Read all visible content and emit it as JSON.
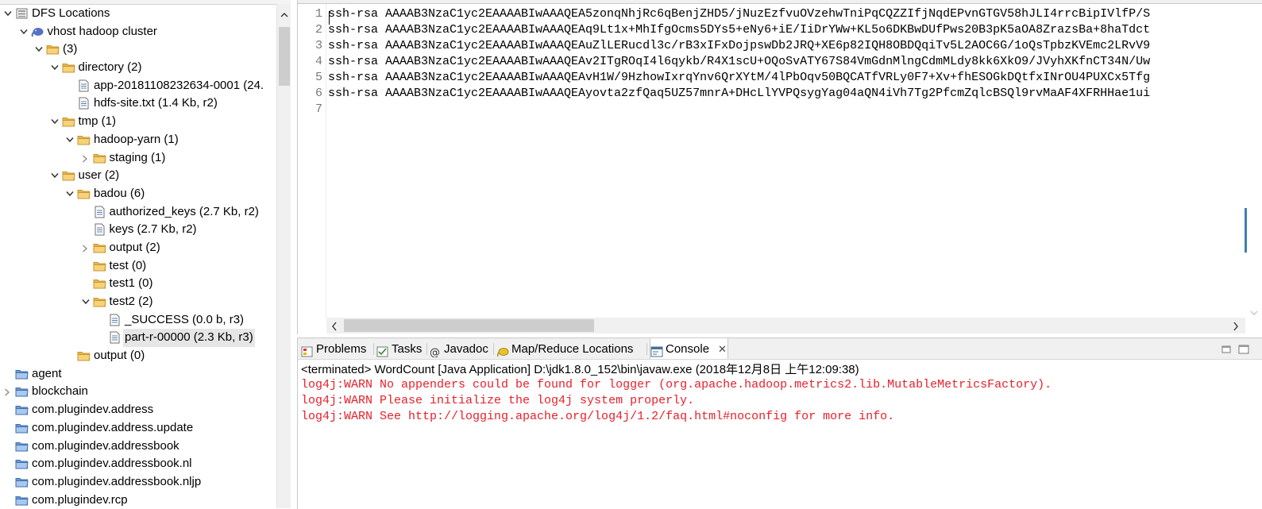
{
  "tree": {
    "items": [
      {
        "label": "DFS Locations",
        "icon": "dfs-locations-icon",
        "twisty": "expanded",
        "depth": 0
      },
      {
        "label": "vhost hadoop cluster",
        "icon": "hadoop-elephant-icon",
        "twisty": "expanded",
        "depth": 1
      },
      {
        "label": "(3)",
        "icon": "folder-icon",
        "twisty": "expanded",
        "depth": 2
      },
      {
        "label": "directory (2)",
        "icon": "folder-icon",
        "twisty": "expanded",
        "depth": 3
      },
      {
        "label": "app-20181108232634-0001 (24.",
        "icon": "file-icon",
        "twisty": "none",
        "depth": 4
      },
      {
        "label": "hdfs-site.txt (1.4 Kb, r2)",
        "icon": "file-icon",
        "twisty": "none",
        "depth": 4
      },
      {
        "label": "tmp (1)",
        "icon": "folder-icon",
        "twisty": "expanded",
        "depth": 3
      },
      {
        "label": "hadoop-yarn (1)",
        "icon": "folder-icon",
        "twisty": "expanded",
        "depth": 4
      },
      {
        "label": "staging (1)",
        "icon": "folder-icon",
        "twisty": "collapsed",
        "depth": 5
      },
      {
        "label": "user (2)",
        "icon": "folder-icon",
        "twisty": "expanded",
        "depth": 3
      },
      {
        "label": "badou (6)",
        "icon": "folder-icon",
        "twisty": "expanded",
        "depth": 4
      },
      {
        "label": "authorized_keys (2.7 Kb, r2)",
        "icon": "file-icon",
        "twisty": "none",
        "depth": 5
      },
      {
        "label": "keys (2.7 Kb, r2)",
        "icon": "file-icon",
        "twisty": "none",
        "depth": 5
      },
      {
        "label": "output (2)",
        "icon": "folder-icon",
        "twisty": "collapsed",
        "depth": 5
      },
      {
        "label": "test (0)",
        "icon": "folder-icon",
        "twisty": "none",
        "depth": 5
      },
      {
        "label": "test1 (0)",
        "icon": "folder-icon",
        "twisty": "none",
        "depth": 5
      },
      {
        "label": "test2 (2)",
        "icon": "folder-icon",
        "twisty": "expanded",
        "depth": 5
      },
      {
        "label": "_SUCCESS (0.0 b, r3)",
        "icon": "file-icon",
        "twisty": "none",
        "depth": 6
      },
      {
        "label": "part-r-00000 (2.3 Kb, r3)",
        "icon": "file-icon",
        "twisty": "none",
        "depth": 6,
        "selected": true
      },
      {
        "label": "output (0)",
        "icon": "folder-icon",
        "twisty": "none",
        "depth": 4
      },
      {
        "label": "agent",
        "icon": "project-icon",
        "twisty": "none",
        "depth": 0
      },
      {
        "label": "blockchain",
        "icon": "project-icon",
        "twisty": "collapsed",
        "depth": 0
      },
      {
        "label": "com.plugindev.address",
        "icon": "project-icon",
        "twisty": "none",
        "depth": 0
      },
      {
        "label": "com.plugindev.address.update",
        "icon": "project-icon",
        "twisty": "none",
        "depth": 0
      },
      {
        "label": "com.plugindev.addressbook",
        "icon": "project-icon",
        "twisty": "none",
        "depth": 0
      },
      {
        "label": "com.plugindev.addressbook.nl",
        "icon": "project-icon",
        "twisty": "none",
        "depth": 0
      },
      {
        "label": "com.plugindev.addressbook.nljp",
        "icon": "project-icon",
        "twisty": "none",
        "depth": 0
      },
      {
        "label": "com.plugindev.rcp",
        "icon": "project-icon",
        "twisty": "none",
        "depth": 0
      }
    ]
  },
  "editor": {
    "line_numbers": [
      "1",
      "2",
      "3",
      "4",
      "5",
      "6",
      "7"
    ],
    "lines": [
      "ssh-rsa AAAAB3NzaC1yc2EAAAABIwAAAQEA5zonqNhjRc6qBenjZHD5/jNuzEzfvuOVzehwTniPqCQZZIfjNqdEPvnGTGV58hJLI4rrcBipIVlfP/S",
      "ssh-rsa AAAAB3NzaC1yc2EAAAABIwAAAQEAq9Lt1x+MhIfgOcms5DYs5+eNy6+iE/IiDrYWw+KL5o6DKBwDUfPws20B3pK5aOA8ZrazsBa+8haTdct",
      "ssh-rsa AAAAB3NzaC1yc2EAAAABIwAAAQEAuZlLERucdl3c/rB3xIFxDojpswDb2JRQ+XE6p82IQH8OBDQqiTv5L2AOC6G/1oQsTpbzKVEmc2LRvV9",
      "ssh-rsa AAAAB3NzaC1yc2EAAAABIwAAAQEAv2ITgROqI4l6qykb/R4X1scU+OQoSvATY67S84VmGdnMlngCdmMLdy8kk6XkO9/JVyhXKfnCT34N/Uw",
      "ssh-rsa AAAAB3NzaC1yc2EAAAABIwAAAQEAvH1W/9HzhowIxrqYnv6QrXYtM/4lPbOqv50BQCATfVRLy0F7+Xv+fhESOGkDQtfxINrOU4PUXCx5Tfg",
      "ssh-rsa AAAAB3NzaC1yc2EAAAABIwAAAQEAyovta2zfQaq5UZ57mnrA+DHcLlYVPQsygYag04aQN4iVh7Tg2PfcmZqlcBSQl9rvMaAF4XFRHHae1ui",
      ""
    ]
  },
  "views": {
    "tabs": [
      {
        "label": "Problems",
        "icon": "problems-icon"
      },
      {
        "label": "Tasks",
        "icon": "tasks-icon"
      },
      {
        "label": "Javadoc",
        "icon": "javadoc-icon"
      },
      {
        "label": "Map/Reduce Locations",
        "icon": "map-reduce-locations-icon"
      },
      {
        "label": "Console",
        "icon": "console-icon",
        "active": true
      }
    ],
    "close_glyph": "✕"
  },
  "console": {
    "status": "<terminated> WordCount [Java Application] D:\\jdk1.8.0_152\\bin\\javaw.exe (2018年12月8日 上午12:09:38)",
    "lines": [
      "log4j:WARN No appenders could be found for logger (org.apache.hadoop.metrics2.lib.MutableMetricsFactory).",
      "log4j:WARN Please initialize the log4j system properly.",
      "log4j:WARN See http://logging.apache.org/log4j/1.2/faq.html#noconfig for more info."
    ],
    "error_color": "#e8202a"
  },
  "colors": {
    "folder": "#e8b64a",
    "folder_dark": "#c99530",
    "file_line": "#5a7fb0",
    "project_blue": "#6b9bd6",
    "hadoop_blue": "#5570c8",
    "selection": "#e6e6e6"
  }
}
